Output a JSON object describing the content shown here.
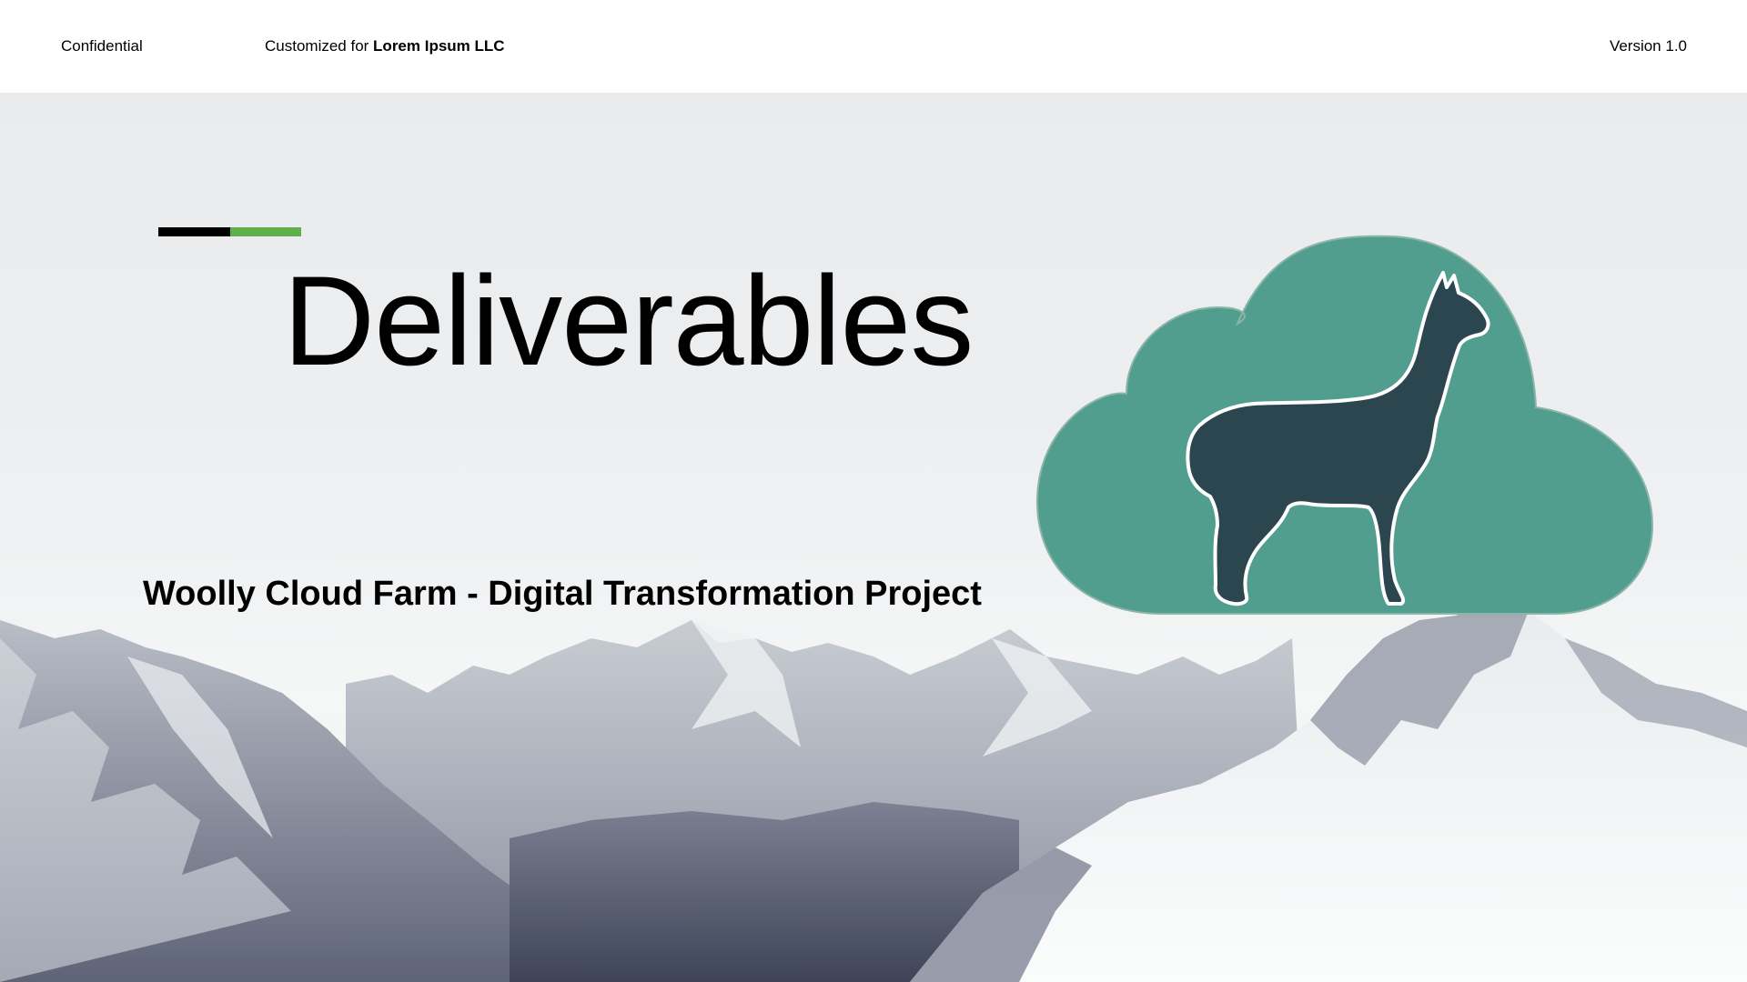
{
  "header": {
    "confidential": "Confidential",
    "customized_prefix": "Customized for ",
    "customer_name": "Lorem Ipsum LLC",
    "version": "Version 1.0"
  },
  "slide": {
    "title": "Deliverables",
    "subtitle": "Woolly Cloud Farm - Digital Transformation Project"
  },
  "colors": {
    "accent_black": "#000000",
    "accent_green": "#5fb04b",
    "logo_cloud": "#519e8e",
    "logo_alpaca": "#2c4650"
  },
  "logo": {
    "icon": "alpaca-cloud-logo"
  },
  "background": {
    "icon": "snowy-mountains-photo"
  }
}
